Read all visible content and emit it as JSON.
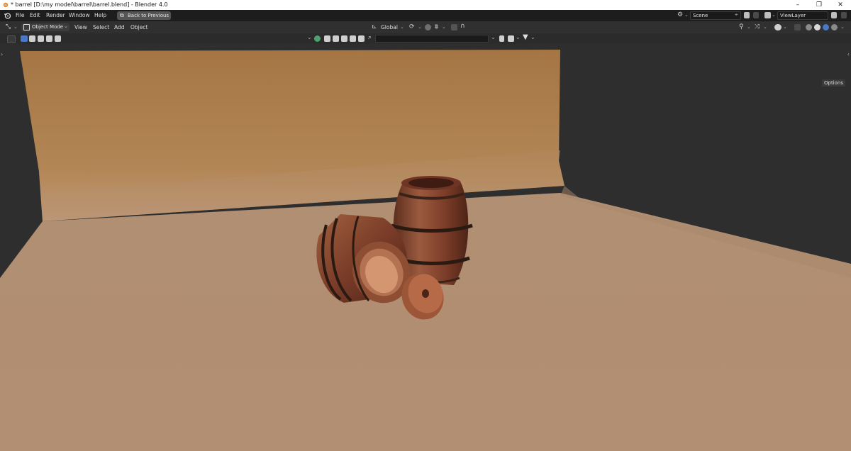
{
  "window": {
    "title": "* barrel [D:\\my model\\barrel\\barrel.blend] - Blender 4.0",
    "min": "–",
    "max": "❐",
    "close": "✕"
  },
  "menu": {
    "items": [
      "File",
      "Edit",
      "Render",
      "Window",
      "Help"
    ],
    "back_button": "Back to Previous"
  },
  "scene": {
    "label": "Scene",
    "view_layer": "ViewLayer"
  },
  "header": {
    "mode": "Object Mode",
    "menus": [
      "View",
      "Select",
      "Add",
      "Object"
    ],
    "orientation": "Global",
    "options": "Options"
  },
  "search": {
    "placeholder": ""
  },
  "colors": {
    "accent": "#4a78c4",
    "backdrop": "#a77a4c",
    "floor": "#b89678",
    "wall": "#2e2e2e",
    "barrel": "#7a3d2a"
  },
  "scene_objects": [
    "barrel-standing",
    "barrel-lying",
    "barrel-lid"
  ]
}
